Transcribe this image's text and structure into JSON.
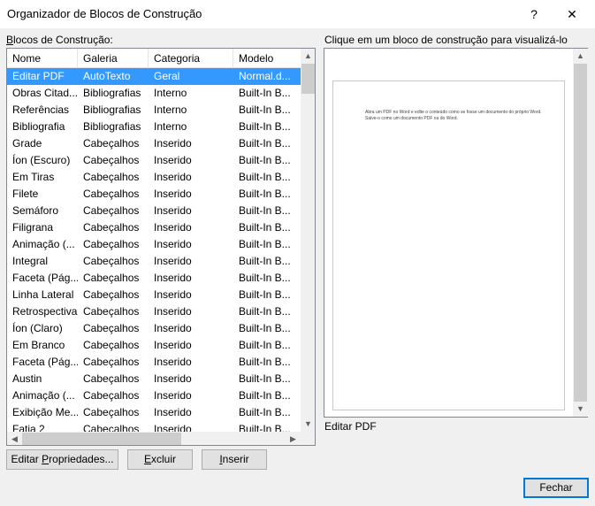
{
  "window": {
    "title": "Organizador de Blocos de Construção",
    "help_label": "?",
    "close_label": "✕"
  },
  "list": {
    "label_prefix": "",
    "label_underlined": "B",
    "label_rest": "locos de Construção:",
    "columns": [
      "Nome",
      "Galeria",
      "Categoria",
      "Modelo"
    ],
    "rows": [
      {
        "nome": "Editar PDF",
        "galeria": "AutoTexto",
        "categoria": "Geral",
        "modelo": "Normal.d...",
        "selected": true
      },
      {
        "nome": "Obras Citad...",
        "galeria": "Bibliografias",
        "categoria": "Interno",
        "modelo": "Built-In B..."
      },
      {
        "nome": "Referências",
        "galeria": "Bibliografias",
        "categoria": "Interno",
        "modelo": "Built-In B..."
      },
      {
        "nome": "Bibliografia",
        "galeria": "Bibliografias",
        "categoria": "Interno",
        "modelo": "Built-In B..."
      },
      {
        "nome": "Grade",
        "galeria": "Cabeçalhos",
        "categoria": "Inserido",
        "modelo": "Built-In B..."
      },
      {
        "nome": "Íon (Escuro)",
        "galeria": "Cabeçalhos",
        "categoria": "Inserido",
        "modelo": "Built-In B..."
      },
      {
        "nome": "Em Tiras",
        "galeria": "Cabeçalhos",
        "categoria": "Inserido",
        "modelo": "Built-In B..."
      },
      {
        "nome": "Filete",
        "galeria": "Cabeçalhos",
        "categoria": "Inserido",
        "modelo": "Built-In B..."
      },
      {
        "nome": "Semáforo",
        "galeria": "Cabeçalhos",
        "categoria": "Inserido",
        "modelo": "Built-In B..."
      },
      {
        "nome": "Filigrana",
        "galeria": "Cabeçalhos",
        "categoria": "Inserido",
        "modelo": "Built-In B..."
      },
      {
        "nome": "Animação (...",
        "galeria": "Cabeçalhos",
        "categoria": "Inserido",
        "modelo": "Built-In B..."
      },
      {
        "nome": "Integral",
        "galeria": "Cabeçalhos",
        "categoria": "Inserido",
        "modelo": "Built-In B..."
      },
      {
        "nome": "Faceta (Pág...",
        "galeria": "Cabeçalhos",
        "categoria": "Inserido",
        "modelo": "Built-In B..."
      },
      {
        "nome": "Linha Lateral",
        "galeria": "Cabeçalhos",
        "categoria": "Inserido",
        "modelo": "Built-In B..."
      },
      {
        "nome": "Retrospectiva",
        "galeria": "Cabeçalhos",
        "categoria": "Inserido",
        "modelo": "Built-In B..."
      },
      {
        "nome": "Íon (Claro)",
        "galeria": "Cabeçalhos",
        "categoria": "Inserido",
        "modelo": "Built-In B..."
      },
      {
        "nome": " Em Branco",
        "galeria": "Cabeçalhos",
        "categoria": "Inserido",
        "modelo": "Built-In B..."
      },
      {
        "nome": "Faceta (Pág...",
        "galeria": "Cabeçalhos",
        "categoria": "Inserido",
        "modelo": "Built-In B..."
      },
      {
        "nome": "Austin",
        "galeria": "Cabeçalhos",
        "categoria": "Inserido",
        "modelo": "Built-In B..."
      },
      {
        "nome": "Animação (...",
        "galeria": "Cabeçalhos",
        "categoria": "Inserido",
        "modelo": "Built-In B..."
      },
      {
        "nome": "Exibição Me...",
        "galeria": "Cabeçalhos",
        "categoria": "Inserido",
        "modelo": "Built-In B..."
      },
      {
        "nome": "Fatia 2",
        "galeria": "Cabeçalhos",
        "categoria": "Inserido",
        "modelo": "Built-In B..."
      }
    ]
  },
  "preview": {
    "label": "Clique em um bloco de construção para visualizá-lo",
    "page_text": "Abra um PDF no Word e edite o conteúdo como se fosse um documento do próprio Word. Salve-o como um documento PDF ou do Word.",
    "selected_name": "Editar PDF"
  },
  "buttons": {
    "edit_properties": "Editar Propriedades...",
    "edit_properties_underline": "P",
    "delete": "Excluir",
    "insert": "Inserir",
    "close": "Fechar"
  },
  "colors": {
    "selection": "#3399ff",
    "accent_border": "#0078d7"
  }
}
